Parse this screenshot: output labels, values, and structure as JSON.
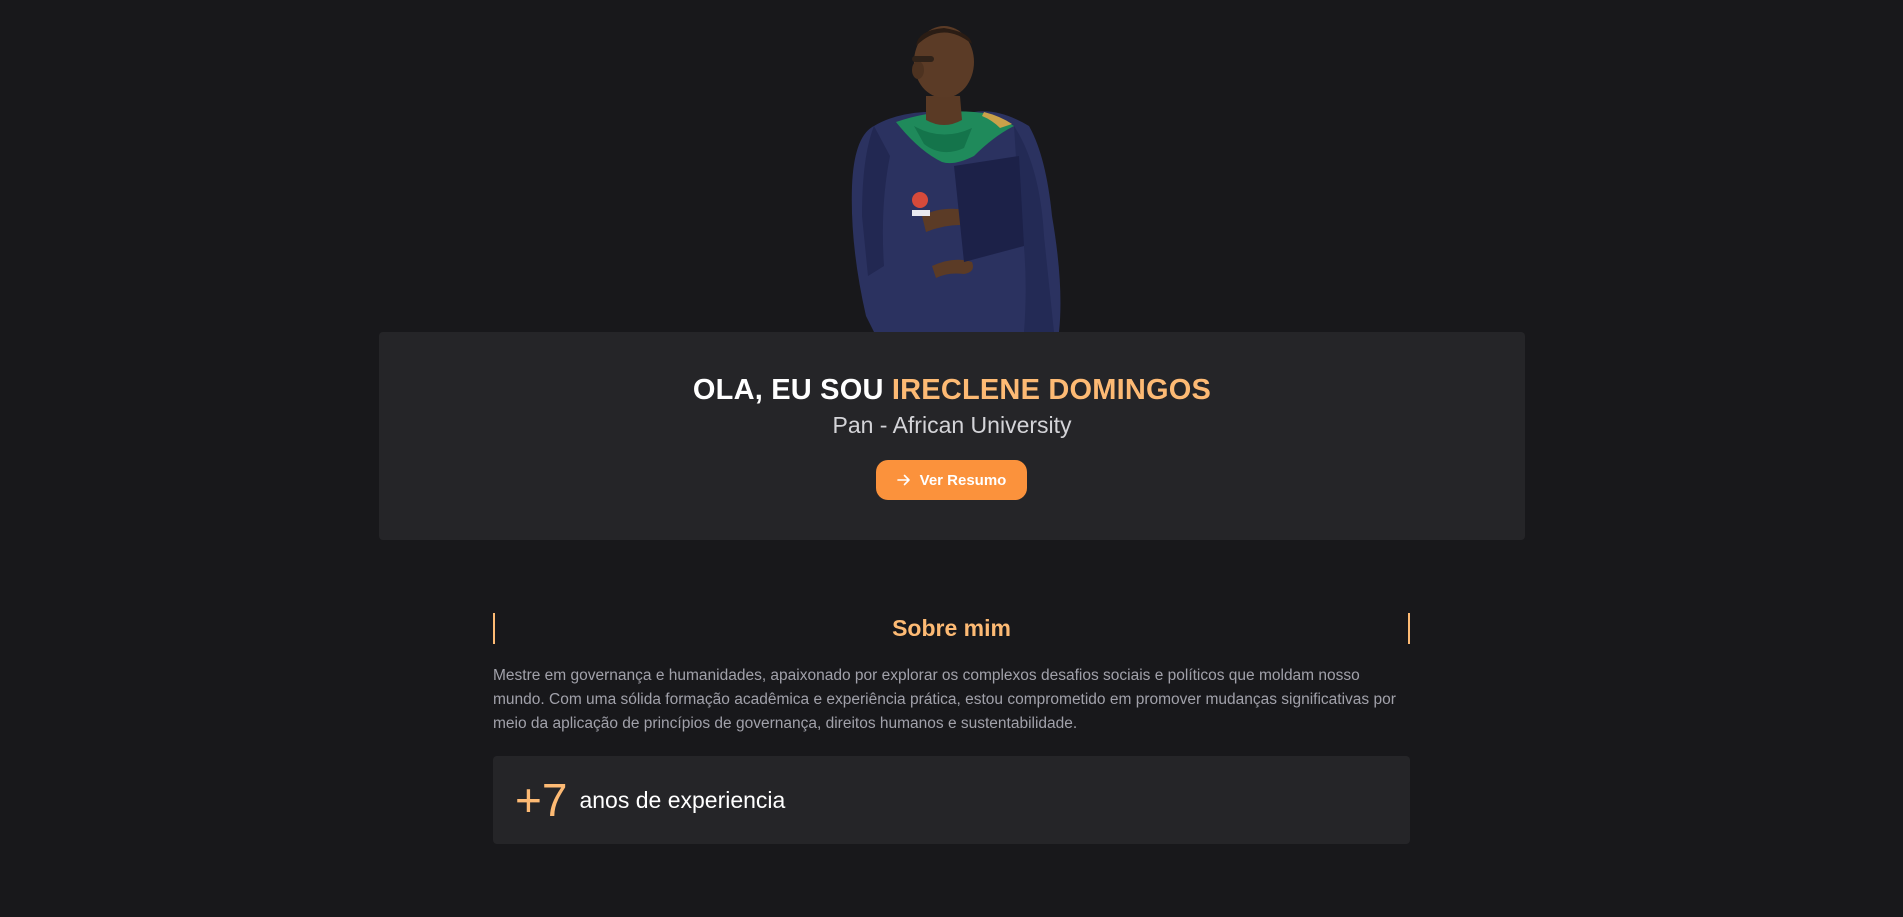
{
  "hero": {
    "title_prefix": "OLA, EU SOU ",
    "title_name": "IRECLENE DOMINGOS",
    "subtitle": "Pan - African University",
    "resume_button_label": "Ver Resumo",
    "resume_button_icon": "arrow-right-icon"
  },
  "portrait": {
    "subject": "graduate-portrait"
  },
  "about": {
    "heading": "Sobre mim",
    "paragraph": "Mestre em governança e humanidades, apaixonado por explorar os complexos desafios sociais e políticos que moldam nosso mundo. Com uma sólida formação acadêmica e experiência prática, estou comprometido em promover mudanças significativas por meio da aplicação de princípios de governança, direitos humanos e sustentabilidade."
  },
  "experience": {
    "number": "+7",
    "label": "anos de experiencia"
  },
  "colors": {
    "background": "#18181b",
    "card": "#252528",
    "accent": "#fdba74",
    "button": "#fb923c"
  }
}
